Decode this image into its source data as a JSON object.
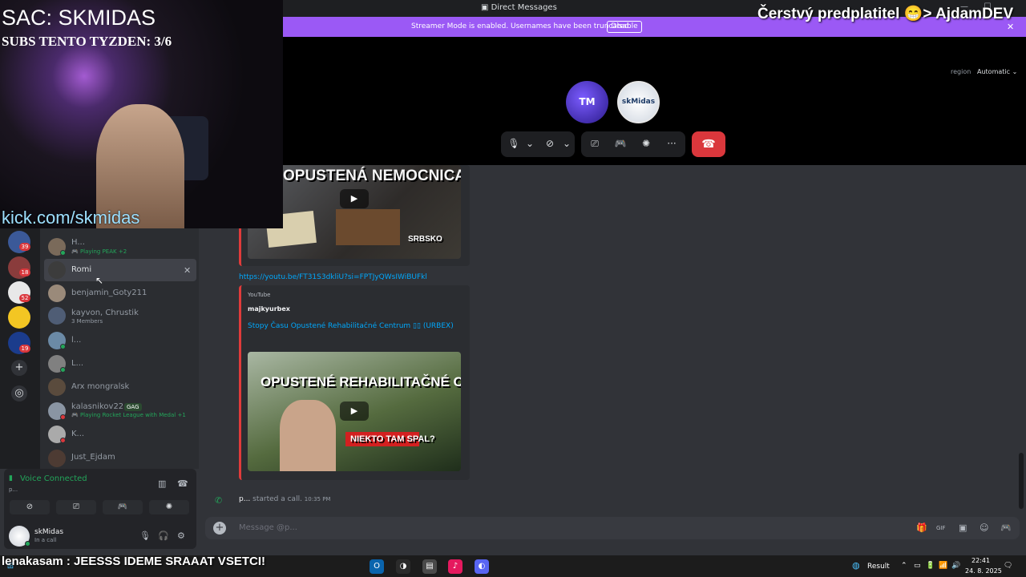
{
  "window": {
    "title": "Direct Messages",
    "minimize_glyph": "—",
    "maximize_glyph": "☐"
  },
  "banner": {
    "message": "Streamer Mode is enabled. Usernames have been truncated.",
    "button": "Disable",
    "close_glyph": "✕",
    "color": "#9b59f5"
  },
  "call": {
    "region_label": "region",
    "region_value": "Automatic ⌄",
    "participant1_initials": "TM",
    "participant2_initials": "skMidas",
    "icons": {
      "mic": "🎙",
      "chevron": "⌄",
      "camera_off": "⊘",
      "screenshare": "⎚",
      "activity": "🎮",
      "soundboard": "✺",
      "more": "···",
      "hangup": "☎"
    },
    "hangup_color": "#da373c"
  },
  "overlay": {
    "sac": "SAC: SKMIDAS",
    "subs": "SUBS TENTO TYZDEN: 3/6",
    "kick": "kick.com/skmidas",
    "sub_alert": "Čerstvý predplatitel 😁> AjdamDEV",
    "chat_line": "lenakasam : JEESSS IDEME SRAAAT VSETCI!"
  },
  "servers": [
    {
      "badge": "39"
    },
    {
      "badge": "18"
    },
    {
      "badge": "52"
    },
    {
      "badge": ""
    },
    {
      "badge": "19"
    }
  ],
  "server_actions": {
    "add": "+",
    "explore": "◎"
  },
  "dms": [
    {
      "name": "H...",
      "sub": "🎮 Playing PEAK +2"
    },
    {
      "name": "Romi",
      "sub": ""
    },
    {
      "name": "benjamin_Goty211",
      "sub": ""
    },
    {
      "name": "kayvon, Chrustik",
      "sub": "3 Members"
    },
    {
      "name": "l...",
      "sub": ""
    },
    {
      "name": "L...",
      "sub": ""
    },
    {
      "name": "Arx mongralsk",
      "sub": ""
    },
    {
      "name": "kalasnikov22",
      "sub": "🎮 Playing Rocket League with Medal +1",
      "badge": "GAG"
    },
    {
      "name": "K...",
      "sub": ""
    },
    {
      "name": "Just_Ejdam",
      "sub": ""
    }
  ],
  "dm_close_glyph": "✕",
  "voice": {
    "title": "Voice Connected",
    "channel": "p...",
    "buttons": [
      "⊘",
      "⎚",
      "🎮",
      "✺"
    ],
    "waveform_icon": "▥",
    "disconnect_icon": "☎"
  },
  "user": {
    "name": "skMidas",
    "status": "In a call",
    "icons": [
      "🎙",
      "🎧",
      "⚙"
    ]
  },
  "chat": {
    "embed1_title": "OPUSTENÁ NEMOCNICA",
    "embed1_tag": "SRBSKO",
    "link": "https://youtu.be/FT31S3dkliU?si=FPTJyQWsIWiBUFkl",
    "provider": "YouTube",
    "author": "majkyurbex",
    "video_title": "Stopy Času Opustené Rehabilitačné Centrum ▯▯ (URBEX)",
    "thumb_title": "OPUSTENÉ REHABILITAČNÉ CENTRUM",
    "thumb_caption": "NIEKTO TAM SPAL?",
    "play_glyph": "▶",
    "call_icon": "✆",
    "call_user": "p...",
    "call_text": " started a call. ",
    "call_time": "10:35 PM",
    "accent_color": "#e03b3b"
  },
  "composer": {
    "plus": "+",
    "placeholder": "Message @p...",
    "icons": [
      "🎁",
      "GIF",
      "▣",
      "☺",
      "🎮"
    ]
  },
  "taskbar": {
    "icons": [
      "⊞",
      "O",
      "◑",
      "▤",
      "♪",
      "◐"
    ],
    "weather": "Result",
    "tray_icons": [
      "⌃",
      "▭",
      "🔋",
      "📶",
      "🔊"
    ],
    "time": "22:41",
    "date": "24. 8. 2025",
    "notifications": "🗨"
  }
}
